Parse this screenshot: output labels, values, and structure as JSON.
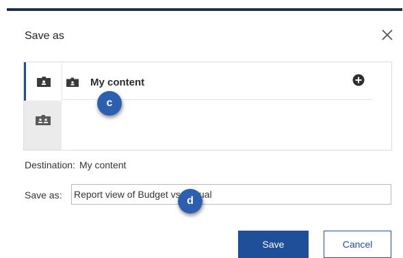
{
  "dialog": {
    "title": "Save as",
    "close_icon": "close-icon"
  },
  "browser": {
    "rail": [
      {
        "icon": "my-content-folder-icon",
        "selected": true
      },
      {
        "icon": "team-content-folder-icon",
        "selected": false
      }
    ],
    "row": {
      "icon": "folder-icon",
      "label": "My content"
    },
    "add_icon": "add-circle-icon"
  },
  "destination": {
    "label": "Destination:",
    "value": "My content"
  },
  "save_as": {
    "label": "Save as:",
    "value": "Report view of Budget vs. Actual"
  },
  "badges": {
    "c": "c",
    "d": "d"
  },
  "buttons": {
    "save": "Save",
    "cancel": "Cancel"
  },
  "colors": {
    "accent": "#1f4f99",
    "badge": "#2c5fb0",
    "topbar": "#1f2d4a"
  }
}
